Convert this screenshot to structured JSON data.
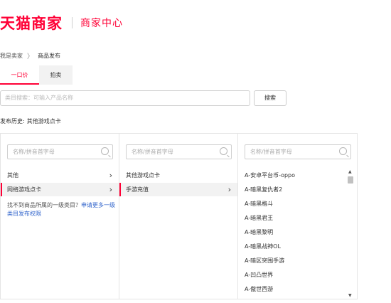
{
  "header": {
    "logo_main": "天猫商家",
    "logo_sub": "商家中心"
  },
  "breadcrumb": {
    "root": "我是卖家",
    "separator": "〉",
    "current": "商品发布"
  },
  "tabs": [
    {
      "label": "一口价",
      "active": true
    },
    {
      "label": "拍卖",
      "active": false
    }
  ],
  "search": {
    "placeholder": "类目搜索：可输入产品名称",
    "button": "搜索"
  },
  "history": {
    "label": "发布历史:",
    "value": "其他游戏点卡"
  },
  "columns": {
    "col1": {
      "placeholder": "名称/拼音首字母",
      "items": [
        {
          "label": "其他",
          "selected": false
        },
        {
          "label": "网络游戏点卡",
          "selected": true
        }
      ],
      "note_text": "找不到商品所属的一级类目？",
      "note_link": "申请更多一级类目发布权限"
    },
    "col2": {
      "placeholder": "名称/拼音首字母",
      "items": [
        {
          "label": "其他游戏点卡",
          "selected": false
        },
        {
          "label": "手游充值",
          "selected": true
        }
      ]
    },
    "col3": {
      "placeholder": "名称/拼音首字母",
      "items": [
        "A-安卓平台币-oppo",
        "A-暗黑复仇者2",
        "A-暗黑格斗",
        "A-暗黑君王",
        "A-暗黑黎明",
        "A-暗黑战神OL",
        "A-暗区突围手游",
        "A-凹凸世界",
        "A-傲世西游"
      ]
    }
  },
  "colors": {
    "accent": "#ff0036",
    "link": "#3366cc"
  },
  "icons": {
    "search": "magnifier-icon",
    "chevron": "chevron-right-icon"
  }
}
